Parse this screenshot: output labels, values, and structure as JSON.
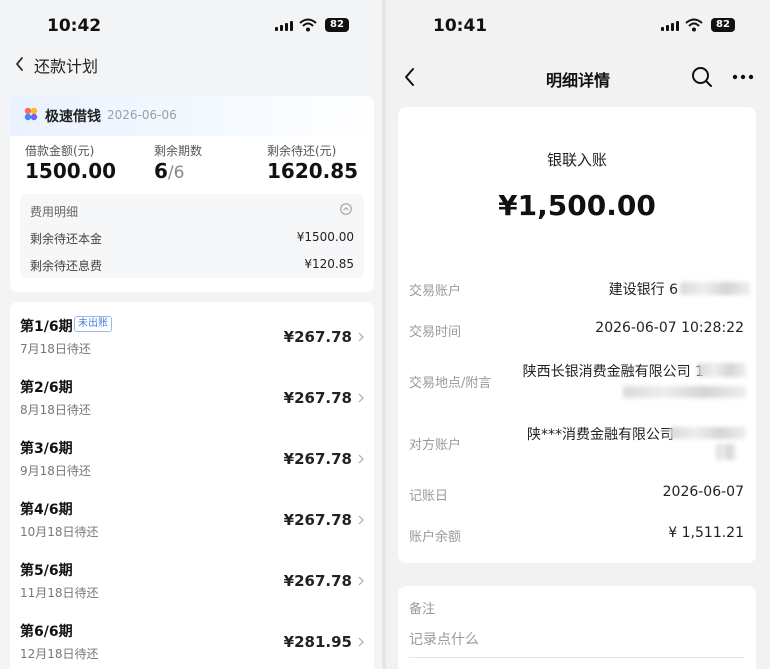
{
  "left_screen": {
    "status_time": "10:42",
    "battery": "82",
    "header": {
      "title": "还款计划"
    },
    "summary": {
      "brand_name": "极速借钱",
      "date": "2026-06-06",
      "loan_amount_label": "借款金额(元)",
      "loan_amount": "1500.00",
      "remaining_periods_label": "剩余期数",
      "remaining_periods": "6",
      "total_periods": "/6",
      "remaining_due_label": "剩余待还(元)",
      "remaining_due": "1620.85",
      "fee_title": "费用明细",
      "principal_label": "剩余待还本金",
      "principal_value": "¥1500.00",
      "interest_label": "剩余待还息费",
      "interest_value": "¥120.85"
    },
    "periods": [
      {
        "name": "第1/6期",
        "badge": "未出账",
        "due": "7月18日待还",
        "amount": "¥267.78"
      },
      {
        "name": "第2/6期",
        "due": "8月18日待还",
        "amount": "¥267.78"
      },
      {
        "name": "第3/6期",
        "due": "9月18日待还",
        "amount": "¥267.78"
      },
      {
        "name": "第4/6期",
        "due": "10月18日待还",
        "amount": "¥267.78"
      },
      {
        "name": "第5/6期",
        "due": "11月18日待还",
        "amount": "¥267.78"
      },
      {
        "name": "第6/6期",
        "due": "12月18日待还",
        "amount": "¥281.95"
      }
    ]
  },
  "right_screen": {
    "status_time": "10:41",
    "battery": "82",
    "header": {
      "title": "明细详情"
    },
    "detail": {
      "channel": "银联入账",
      "amount": "¥1,500.00",
      "account_label": "交易账户",
      "account_value": "建设银行 6",
      "time_label": "交易时间",
      "time_value": "2026-06-07 10:28:22",
      "place_label": "交易地点/附言",
      "place_value": "陕西长银消费金融有限公司 1",
      "counterparty_label": "对方账户",
      "counterparty_value": "陕***消费金融有限公司",
      "post_date_label": "记账日",
      "post_date_value": "2026-06-07",
      "balance_label": "账户余额",
      "balance_value": "¥ 1,511.21"
    },
    "remark": {
      "label": "备注",
      "placeholder": "记录点什么"
    }
  }
}
